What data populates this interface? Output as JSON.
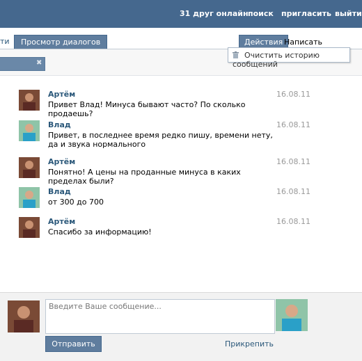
{
  "topbar": {
    "friends_online": "31 друг онлайн",
    "search": "поиск",
    "invite": "пригласить",
    "logout": "выйти"
  },
  "tabs": {
    "partial_left": "ти",
    "dialogs": "Просмотр диалогов",
    "actions": "Действия",
    "write": "Написать сообщение"
  },
  "actions_menu": {
    "clear_history": "Очистить историю сообщений",
    "icon": "trash-icon"
  },
  "filter": {
    "clear_icon": "✖"
  },
  "messages": [
    {
      "name": "Артём",
      "text": "Привет Влад! Минуса бывают часто? По сколько продаешь?",
      "date": "16.08.11"
    },
    {
      "name": "Влад",
      "text": "Привет, в последнее время редко пишу, времени нету, да и звука нормального",
      "date": "16.08.11"
    },
    {
      "name": "Артём",
      "text": "Понятно! А цены на проданные минуса в каких пределах были?",
      "date": "16.08.11"
    },
    {
      "name": "Влад",
      "text": "от 300 до 700",
      "date": "16.08.11"
    },
    {
      "name": "Артём",
      "text": "Спасибо за информацию!",
      "date": "16.08.11"
    }
  ],
  "compose": {
    "placeholder": "Введите Ваше сообщение...",
    "send": "Отправить",
    "attach": "Прикрепить"
  },
  "colors": {
    "header": "#45688e",
    "tab_active": "#5f7d9e",
    "link": "#2b587a"
  }
}
